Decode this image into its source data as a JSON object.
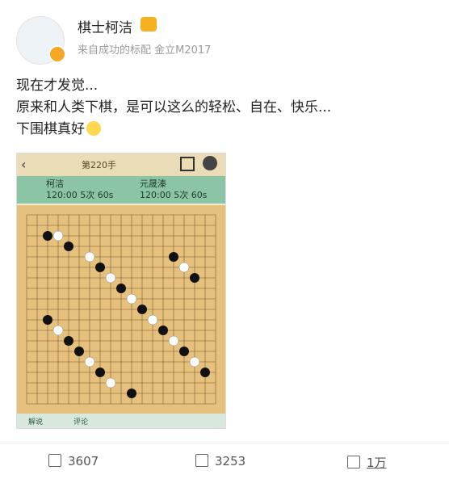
{
  "user": {
    "name": "棋士柯洁",
    "source": "来自成功的标配 金立M2017"
  },
  "post": {
    "lines": [
      "现在才发觉...",
      "原来和人类下棋，是可以这么的轻松、自在、快乐...",
      "下围棋真好"
    ]
  },
  "screenshot": {
    "move_label": "第220手",
    "player1": {
      "name": "柯洁",
      "time": "120:00  5次 60s"
    },
    "player2": {
      "name": "元晟溱",
      "time": "120:00  5次 60s"
    },
    "tab1": "解说",
    "tab2": "评论"
  },
  "actions": {
    "reposts": "3607",
    "comments": "3253",
    "likes": "1万"
  },
  "colors": {
    "board": "#e6c07d",
    "accent": "#f5a623"
  }
}
